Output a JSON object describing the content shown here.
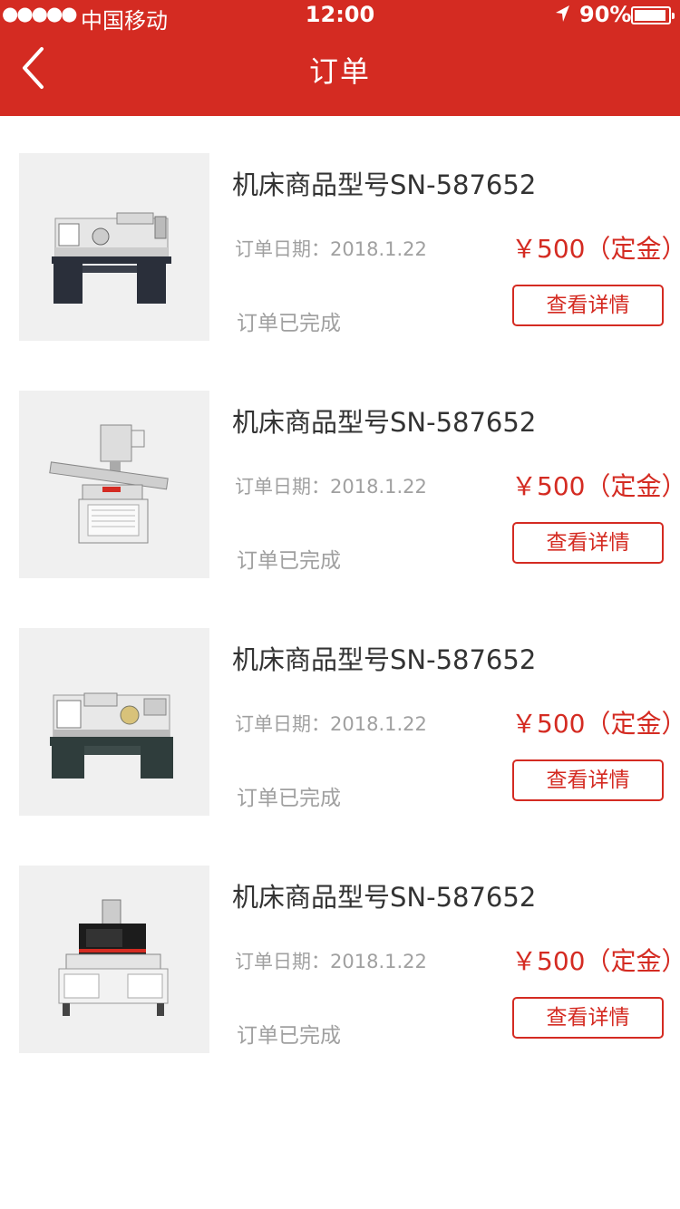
{
  "status_bar": {
    "signal": "●●●●●",
    "carrier": "中国移动",
    "time": "12:00",
    "battery_percent": "90%"
  },
  "header": {
    "title": "订单",
    "background_color": "#d42b22"
  },
  "orders": [
    {
      "name": "机床商品型号SN-587652",
      "date": "订单日期：2018.1.22",
      "price": "￥500（定金）",
      "status": "订单已完成",
      "button_label": "查看详情"
    },
    {
      "name": "机床商品型号SN-587652",
      "date": "订单日期：2018.1.22",
      "price": "￥500（定金）",
      "status": "订单已完成",
      "button_label": "查看详情"
    },
    {
      "name": "机床商品型号SN-587652",
      "date": "订单日期：2018.1.22",
      "price": "￥500（定金）",
      "status": "订单已完成",
      "button_label": "查看详情"
    },
    {
      "name": "机床商品型号SN-587652",
      "date": "订单日期：2018.1.22",
      "price": "￥500（定金）",
      "status": "订单已完成",
      "button_label": "查看详情"
    }
  ],
  "accent_color": "#d42b22"
}
